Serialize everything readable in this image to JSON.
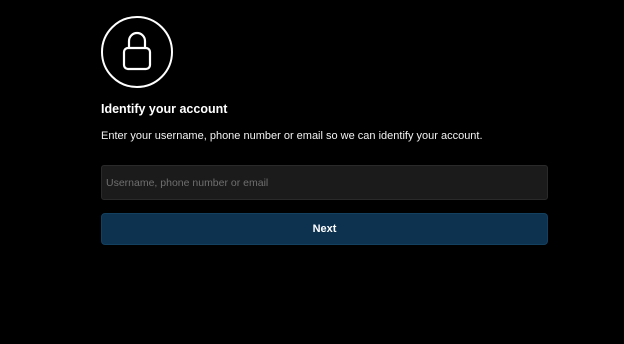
{
  "icon": {
    "name": "lock-icon",
    "color": "#ffffff"
  },
  "form": {
    "heading": "Identify your account",
    "description": "Enter your username, phone number or email so we can identify your account.",
    "input": {
      "placeholder": "Username, phone number or email",
      "value": ""
    },
    "next_label": "Next"
  },
  "colors": {
    "background": "#000000",
    "input_background": "#1b1b1b",
    "button_background": "#0c3250",
    "text": "#ffffff"
  }
}
